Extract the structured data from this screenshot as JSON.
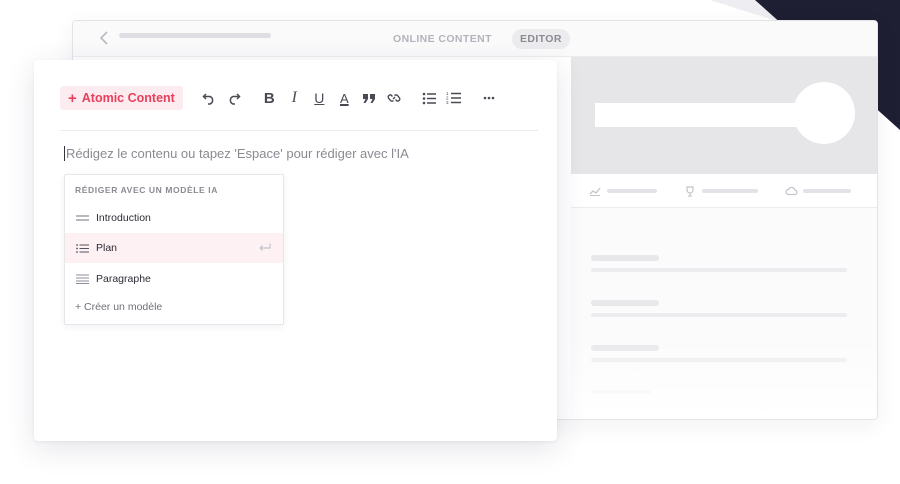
{
  "colors": {
    "accent": "#e8405c",
    "accent_bg": "#fdecef",
    "corner_dark": "#1f1f33"
  },
  "background_window": {
    "tabs": [
      {
        "label": "ONLINE CONTENT",
        "active": false
      },
      {
        "label": "EDITOR",
        "active": true
      }
    ],
    "stat_icons": [
      "trend-icon",
      "trophy-icon",
      "cloud-icon"
    ]
  },
  "editor": {
    "atomic_button_label": "Atomic Content",
    "toolbar_icons": [
      "undo-icon",
      "redo-icon",
      "bold-icon",
      "italic-icon",
      "underline-icon",
      "text-color-icon",
      "quote-icon",
      "link-icon",
      "bullet-list-icon",
      "numbered-list-icon",
      "more-icon"
    ],
    "placeholder": "Rédigez le contenu ou tapez 'Espace' pour rédiger avec l'IA",
    "ai_menu": {
      "title": "RÉDIGER AVEC UN MODÈLE IA",
      "items": [
        {
          "label": "Introduction",
          "icon": "introduction-icon",
          "active": false
        },
        {
          "label": "Plan",
          "icon": "plan-list-icon",
          "active": true
        },
        {
          "label": "Paragraphe",
          "icon": "paragraph-icon",
          "active": false
        }
      ],
      "create_label": "+ Créer un modèle"
    }
  }
}
